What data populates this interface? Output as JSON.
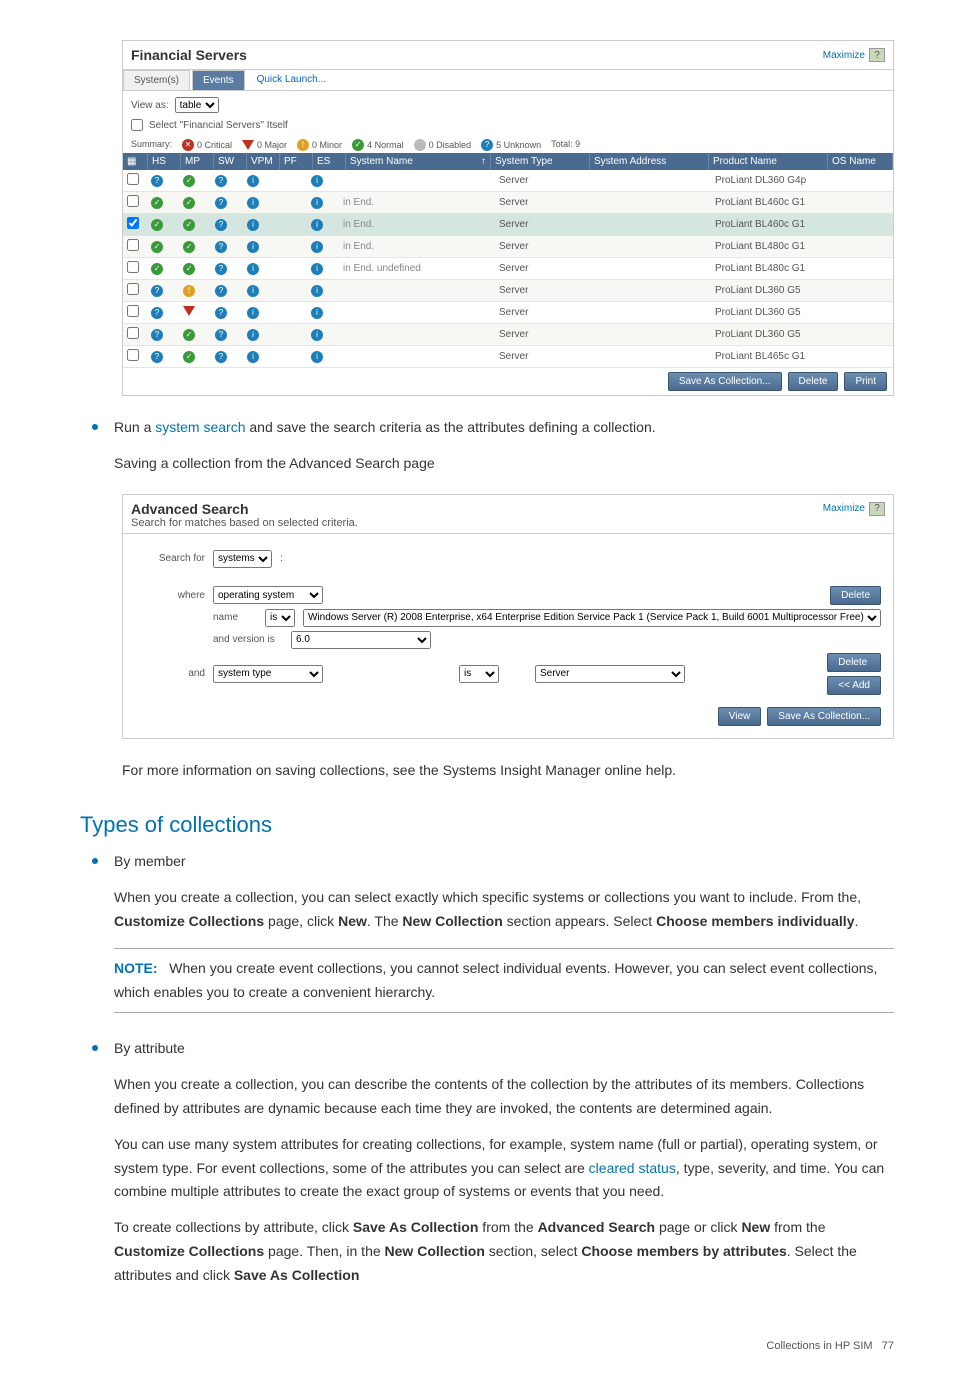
{
  "financial_panel": {
    "title": "Financial Servers",
    "maximize": "Maximize",
    "help": "?",
    "tabs": {
      "systems": "System(s)",
      "events": "Events",
      "quick": "Quick Launch..."
    },
    "view_as_label": "View as:",
    "view_as_value": "table",
    "select_itself": "Select \"Financial Servers\" Itself",
    "summary": {
      "prefix": "Summary:",
      "critical": "0 Critical",
      "major": "0 Major",
      "minor": "0 Minor",
      "normal": "4 Normal",
      "disabled": "0 Disabled",
      "unknown": "5 Unknown",
      "total": "Total: 9"
    },
    "headers": {
      "hs": "HS",
      "mp": "MP",
      "sw": "SW",
      "vpm": "VPM",
      "pf": "PF",
      "es": "ES",
      "name": "System Name",
      "type": "System Type",
      "addr": "System Address",
      "prod": "Product Name",
      "os": "OS Name"
    },
    "rows": [
      {
        "sel": false,
        "alt": false,
        "hs": "unk",
        "mp": "ok",
        "sw": "unk",
        "vpm": "info",
        "es": "info",
        "name": "",
        "sub": "",
        "type": "Server",
        "prod": "ProLiant DL360 G4p"
      },
      {
        "sel": false,
        "alt": true,
        "hs": "ok",
        "mp": "ok",
        "sw": "unk",
        "vpm": "info",
        "es": "info",
        "name": "",
        "sub": "in End.",
        "type": "Server",
        "prod": "ProLiant BL460c G1"
      },
      {
        "sel": true,
        "alt": false,
        "hs": "ok",
        "mp": "ok",
        "sw": "unk",
        "vpm": "info",
        "es": "info",
        "name": "",
        "sub": "in End.",
        "type": "Server",
        "prod": "ProLiant BL460c G1"
      },
      {
        "sel": false,
        "alt": true,
        "hs": "ok",
        "mp": "ok",
        "sw": "unk",
        "vpm": "info",
        "es": "info",
        "name": "",
        "sub": "in End.",
        "type": "Server",
        "prod": "ProLiant BL480c G1"
      },
      {
        "sel": false,
        "alt": false,
        "hs": "ok",
        "mp": "ok",
        "sw": "unk",
        "vpm": "info",
        "es": "info",
        "name": "",
        "sub": "in End. undefined",
        "type": "Server",
        "prod": "ProLiant BL480c G1"
      },
      {
        "sel": false,
        "alt": true,
        "hs": "unk",
        "mp": "warn",
        "sw": "unk",
        "vpm": "info",
        "es": "info",
        "name": "",
        "sub": "",
        "type": "Server",
        "prod": "ProLiant DL360 G5"
      },
      {
        "sel": false,
        "alt": false,
        "hs": "unk",
        "mp": "crit",
        "sw": "unk",
        "vpm": "info",
        "es": "info",
        "name": "",
        "sub": "",
        "type": "Server",
        "prod": "ProLiant DL360 G5"
      },
      {
        "sel": false,
        "alt": true,
        "hs": "unk",
        "mp": "ok",
        "sw": "unk",
        "vpm": "info",
        "es": "info",
        "name": "",
        "sub": "",
        "type": "Server",
        "prod": "ProLiant DL360 G5"
      },
      {
        "sel": false,
        "alt": false,
        "hs": "unk",
        "mp": "ok",
        "sw": "unk",
        "vpm": "info",
        "es": "info",
        "name": "",
        "sub": "",
        "type": "Server",
        "prod": "ProLiant BL465c G1"
      }
    ],
    "buttons": {
      "save": "Save As Collection...",
      "delete": "Delete",
      "print": "Print"
    }
  },
  "mid_text": {
    "line1_a": "Run a ",
    "line1_link": "system search",
    "line1_b": " and save the search criteria as the attributes defining a collection.",
    "line2": "Saving a collection from the Advanced Search page"
  },
  "advanced_panel": {
    "title": "Advanced Search",
    "subtitle": "Search for matches based on selected criteria.",
    "maximize": "Maximize",
    "help": "?",
    "search_for": "Search for",
    "search_for_value": "systems",
    "where": "where",
    "c1": "operating system",
    "c1_name": "name",
    "c1_is": "is",
    "c1_val": "Windows Server (R) 2008 Enterprise, x64 Enterprise Edition Service Pack 1 (Service Pack 1, Build 6001 Multiprocessor Free)",
    "c1_ver_lbl": "and version is",
    "c1_ver": "6.0",
    "and": "and",
    "c2": "system type",
    "c2_is": "is",
    "c2_val": "Server",
    "btn_delete": "Delete",
    "btn_add": "<< Add",
    "btn_view": "View",
    "btn_save": "Save As Collection..."
  },
  "post_text": "For more information on saving collections, see the Systems Insight Manager online help.",
  "section_heading": "Types of collections",
  "by_member": {
    "title": "By member",
    "p1_a": "When you create a collection, you can select exactly which specific systems or collections you want to include. From the, ",
    "p1_b": "Customize Collections",
    "p1_c": " page, click ",
    "p1_d": "New",
    "p1_e": ". The ",
    "p1_f": "New Collection",
    "p1_g": " section appears. Select ",
    "p1_h": "Choose members individually",
    "p1_i": ".",
    "note_label": "NOTE:",
    "note": "When you create event collections, you cannot select individual events. However, you can select event collections, which enables you to create a convenient hierarchy."
  },
  "by_attr": {
    "title": "By attribute",
    "p1": "When you create a collection, you can describe the contents of the collection by the attributes of its members. Collections defined by attributes are dynamic because each time they are invoked, the contents are determined again.",
    "p2_a": "You can use many system attributes for creating collections, for example, system name (full or partial), operating system, or system type. For event collections, some of the attributes you can select are ",
    "p2_link": "cleared status",
    "p2_b": ", type, severity, and time. You can combine multiple attributes to create the exact group of systems or events that you need.",
    "p3_a": "To create collections by attribute, click ",
    "p3_b": "Save As Collection",
    "p3_c": " from the ",
    "p3_d": "Advanced Search",
    "p3_e": " page or click ",
    "p3_f": "New",
    "p3_g": " from the ",
    "p3_h": "Customize Collections",
    "p3_i": " page. Then, in the ",
    "p3_j": "New Collection",
    "p3_k": " section, select ",
    "p3_l": "Choose members by attributes",
    "p3_m": ". Select the attributes and click ",
    "p3_n": "Save As Collection"
  },
  "footer": {
    "label": "Collections in HP SIM",
    "page": "77"
  }
}
